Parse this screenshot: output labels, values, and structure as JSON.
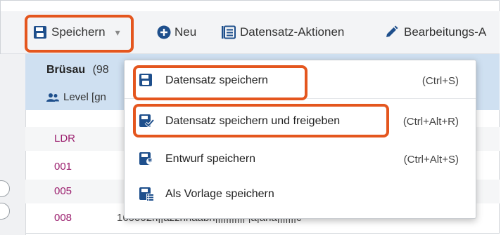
{
  "toolbar": {
    "save_label": "Speichern",
    "new_label": "Neu",
    "record_actions_label": "Datensatz-Aktionen",
    "edit_label": "Bearbeitungs-A"
  },
  "record": {
    "title": "Brüsau",
    "title_suffix": "(98",
    "level": "Level [gn"
  },
  "rows": [
    {
      "tag": "LDR"
    },
    {
      "tag": "001"
    },
    {
      "tag": "005"
    },
    {
      "tag": "008",
      "value": "160002n||azznnaabn||||||||||| |a|ana|||||||c"
    }
  ],
  "menu": {
    "items": [
      {
        "label": "Datensatz speichern",
        "shortcut": "(Ctrl+S)"
      },
      {
        "label": "Datensatz speichern und freigeben",
        "shortcut": "(Ctrl+Alt+R)"
      },
      {
        "label": "Entwurf speichern",
        "shortcut": "(Ctrl+Alt+S)"
      },
      {
        "label": "Als Vorlage speichern",
        "shortcut": ""
      }
    ]
  },
  "colors": {
    "highlight": "#e4561e",
    "brand_blue": "#1e4f8c",
    "header_blue": "#cfe0f1",
    "tag_purple": "#9b1f6e"
  }
}
